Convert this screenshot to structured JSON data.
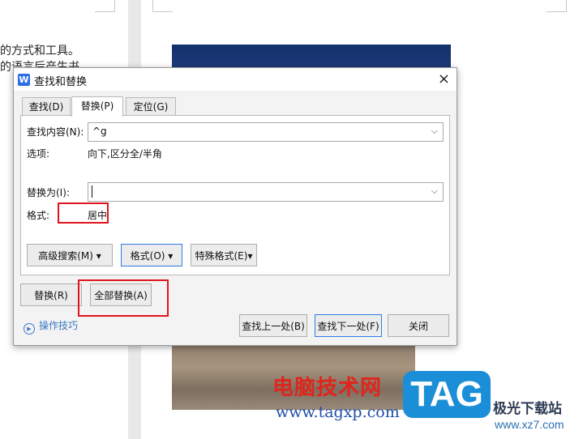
{
  "document": {
    "line1": "的方式和工具。",
    "line2": "的语言后产生书"
  },
  "dialog": {
    "title": "查找和替换",
    "app_icon": "W",
    "close_icon": "×",
    "tabs": [
      {
        "label": "查找(D)",
        "active": false
      },
      {
        "label": "替换(P)",
        "active": true
      },
      {
        "label": "定位(G)",
        "active": false
      }
    ],
    "find": {
      "label": "查找内容(N):",
      "value": "^g",
      "options_label": "选项:",
      "options_value": "向下,区分全/半角"
    },
    "replace": {
      "label": "替换为(I):",
      "value": "",
      "format_label": "格式:",
      "format_value": "居中"
    },
    "buttons": {
      "advanced_search": "高级搜索(M) ▾",
      "format": "格式(O) ▾",
      "special_format": "特殊格式(E)▾",
      "replace": "替换(R)",
      "replace_all": "全部替换(A)",
      "find_prev": "查找上一处(B)",
      "find_next": "查找下一处(F)",
      "close": "关闭"
    },
    "tips": "操作技巧",
    "highlight_color": "#e0141e",
    "accent_color": "#2c7be5"
  },
  "watermark": {
    "site_name": "电脑技术网",
    "url": "www.tagxp.com",
    "logo": "TAG",
    "brand": "极光下载站",
    "brand_url": "www.xz7.com"
  }
}
